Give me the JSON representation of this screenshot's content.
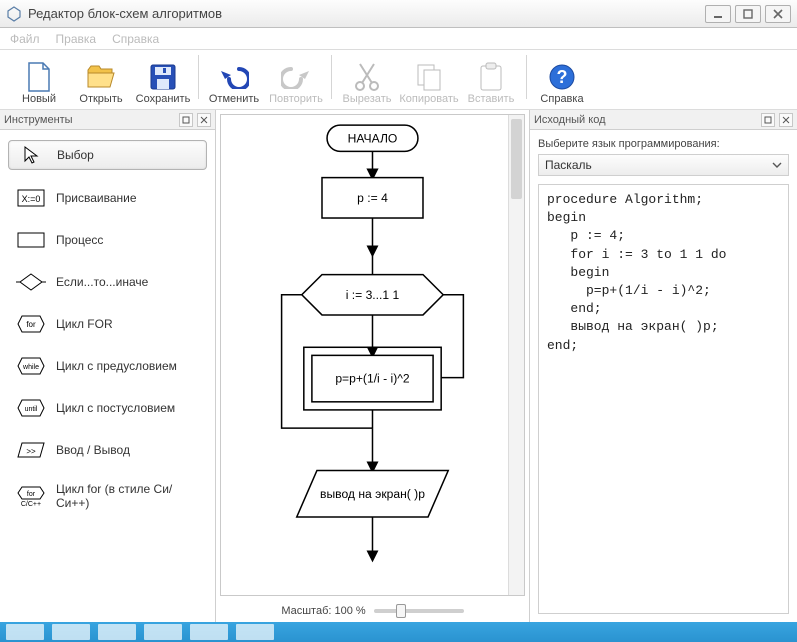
{
  "window": {
    "title": "Редактор блок-схем алгоритмов"
  },
  "menu": {
    "file": "Файл",
    "edit": "Правка",
    "help": "Справка"
  },
  "toolbar": {
    "new": "Новый",
    "open": "Открыть",
    "save": "Сохранить",
    "undo": "Отменить",
    "redo": "Повторить",
    "cut": "Вырезать",
    "copy": "Копировать",
    "paste": "Вставить",
    "about": "Справка"
  },
  "panels": {
    "tools_title": "Инструменты",
    "code_title": "Исходный код"
  },
  "tools": {
    "select": "Выбор",
    "assign": "Присваивание",
    "process": "Процесс",
    "ifelse": "Если...то...иначе",
    "for": "Цикл FOR",
    "while": "Цикл с предусловием",
    "until": "Цикл с постусловием",
    "io": "Ввод / Вывод",
    "forC": "Цикл for (в стиле Си/Си++)"
  },
  "flow": {
    "start": "НАЧАЛО",
    "assign": "p := 4",
    "loop": "i := 3...1 1",
    "body": "p=p+(1/i - i)^2",
    "output": "вывод на экран( )p"
  },
  "zoom": {
    "label": "Масштаб: 100 %"
  },
  "source": {
    "lang_label": "Выберите язык программирования:",
    "lang_value": "Паскаль",
    "code": "procedure Algorithm;\nbegin\n   p := 4;\n   for i := 3 to 1 1 do\n   begin\n     p=p+(1/i - i)^2;\n   end;\n   вывод на экран( )p;\nend;"
  }
}
